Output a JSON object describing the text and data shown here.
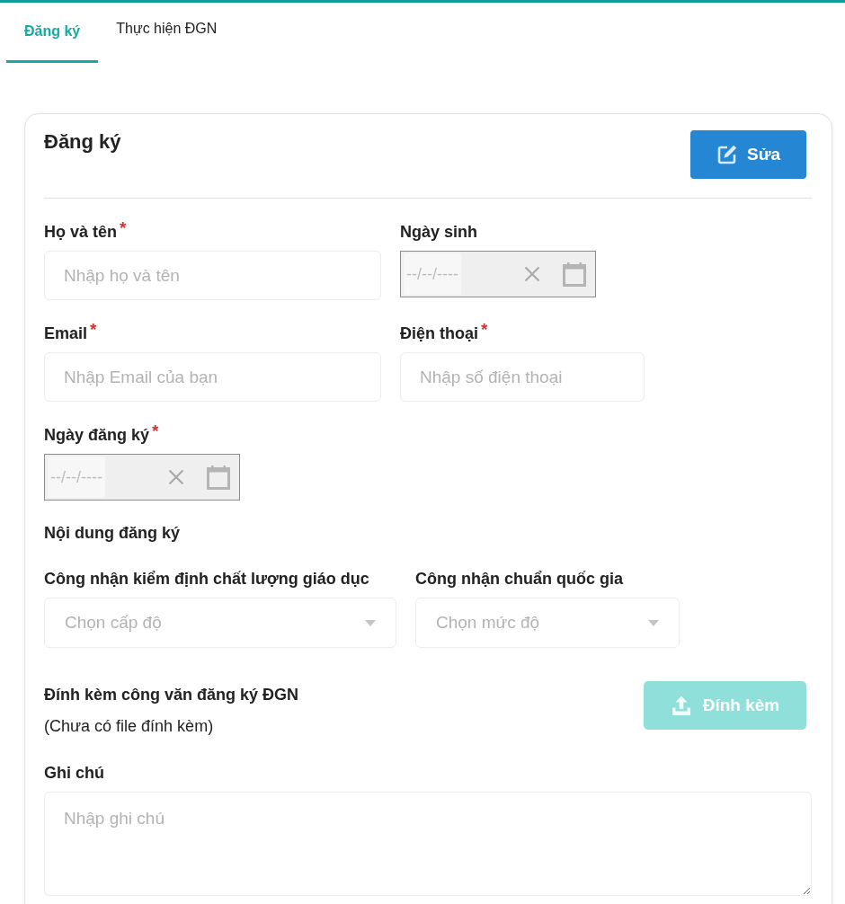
{
  "tabs": [
    {
      "label": "Đăng ký",
      "selected": true
    },
    {
      "label": "Thực hiện ĐGN",
      "selected": false
    }
  ],
  "card": {
    "title": "Đăng ký",
    "edit_button": {
      "label": "Sửa"
    },
    "rows": [
      {
        "fields": [
          {
            "kind": "text",
            "label": "Họ và tên",
            "required_mark": "*",
            "placeholder": "Nhập họ và tên"
          },
          {
            "kind": "date",
            "label": "Ngày sinh",
            "placeholder": "--/--/----"
          }
        ]
      },
      {
        "fields": [
          {
            "kind": "text",
            "label": "Email",
            "required_mark": "*",
            "placeholder": "Nhập Email của bạn"
          },
          {
            "kind": "text",
            "label": "Điện thoại",
            "required_mark": "*",
            "placeholder": "Nhập số điện thoại"
          }
        ]
      },
      {
        "fields": [
          {
            "kind": "date",
            "label": "Ngày đăng ký",
            "required_mark": "*",
            "placeholder": "--/--/----"
          }
        ]
      }
    ],
    "section_title": "Nội dung đăng ký",
    "selects": [
      {
        "label": "Công nhận kiểm định chất lượng giáo dục",
        "placeholder": "Chọn cấp độ"
      },
      {
        "label": "Công nhận chuẩn quốc gia",
        "placeholder": "Chọn mức độ"
      }
    ],
    "attachment": {
      "title": "Đính kèm công văn đăng ký ĐGN",
      "status": "(Chưa có file đính kèm)",
      "button": {
        "label": "Đính kèm",
        "disabled": true
      }
    },
    "notes": {
      "label": "Ghi chú",
      "placeholder": "Nhập ghi chú"
    }
  }
}
